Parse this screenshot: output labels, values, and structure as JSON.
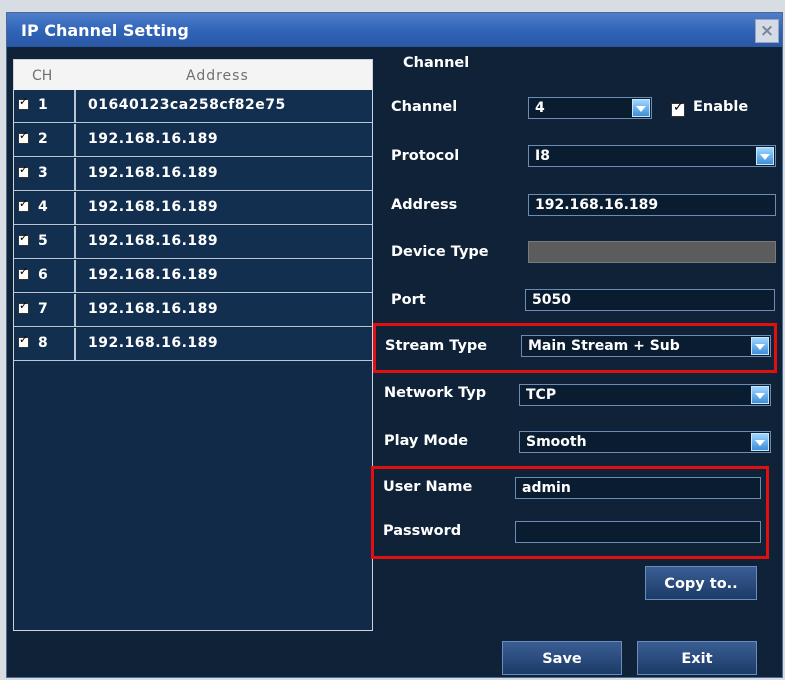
{
  "window": {
    "title": "IP Channel Setting",
    "close_glyph": "×"
  },
  "list": {
    "header_ch": "CH",
    "header_address": "Address",
    "rows": [
      {
        "ch": "1",
        "address": "01640123ca258cf82e75",
        "checked": true
      },
      {
        "ch": "2",
        "address": "192.168.16.189",
        "checked": true
      },
      {
        "ch": "3",
        "address": "192.168.16.189",
        "checked": true
      },
      {
        "ch": "4",
        "address": "192.168.16.189",
        "checked": true
      },
      {
        "ch": "5",
        "address": "192.168.16.189",
        "checked": true
      },
      {
        "ch": "6",
        "address": "192.168.16.189",
        "checked": true
      },
      {
        "ch": "7",
        "address": "192.168.16.189",
        "checked": true
      },
      {
        "ch": "8",
        "address": "192.168.16.189",
        "checked": true
      }
    ]
  },
  "form": {
    "section_title": "Channel",
    "channel_label": "Channel",
    "channel_value": "4",
    "enable_label": "Enable",
    "protocol_label": "Protocol",
    "protocol_value": "I8",
    "address_label": "Address",
    "address_value": "192.168.16.189",
    "device_type_label": "Device Type",
    "device_type_value": "",
    "port_label": "Port",
    "port_value": "5050",
    "stream_type_label": "Stream Type",
    "stream_type_value": "Main Stream + Sub",
    "network_type_label": "Network Typ",
    "network_type_value": "TCP",
    "play_mode_label": "Play Mode",
    "play_mode_value": "Smooth",
    "user_name_label": "User Name",
    "user_name_value": "admin",
    "password_label": "Password",
    "password_value": ""
  },
  "buttons": {
    "copy_to": "Copy to..",
    "save": "Save",
    "exit": "Exit"
  },
  "colors": {
    "highlight": "#e01010",
    "title_bar": "#2f63b6",
    "panel_bg": "#0f2238"
  }
}
